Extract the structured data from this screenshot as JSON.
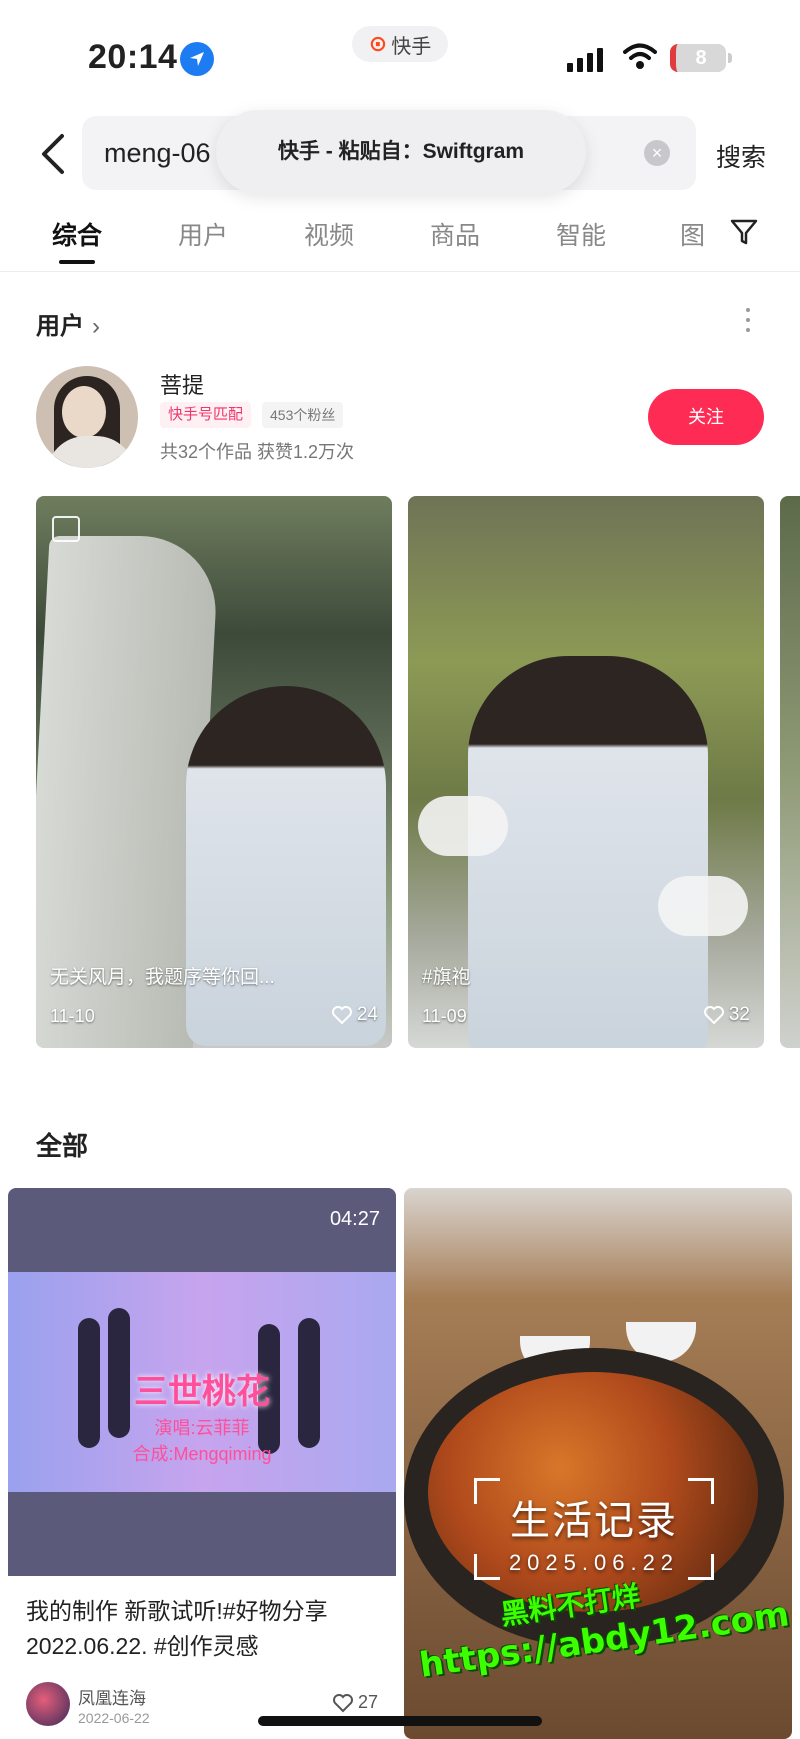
{
  "status_bar": {
    "time": "20:14",
    "island_label": "快手",
    "battery": "8"
  },
  "search": {
    "query": "meng-06",
    "submit_label": "搜索",
    "paste_toast": "快手 - 粘贴自：Swiftgram"
  },
  "tabs": [
    {
      "label": "综合",
      "active": true
    },
    {
      "label": "用户"
    },
    {
      "label": "视频"
    },
    {
      "label": "商品"
    },
    {
      "label": "智能"
    },
    {
      "label": "图"
    }
  ],
  "user_section": {
    "title": "用户",
    "user": {
      "name": "菩提",
      "match_badge": "快手号匹配",
      "fans": "453个粉丝",
      "stats": "共32个作品 获赞1.2万次",
      "follow_label": "关注"
    },
    "photos": [
      {
        "caption": "无关风月，我题序等你回...",
        "date": "11-10",
        "likes": "24"
      },
      {
        "caption": "#旗袍",
        "date": "11-09",
        "likes": "32"
      }
    ]
  },
  "all_section": {
    "title": "全部",
    "cards": [
      {
        "duration": "04:27",
        "song_title": "三世桃花",
        "singer": "演唱:云菲菲",
        "mixer": "合成:Mengqiming",
        "description": "我的制作 新歌试听!#好物分享 2022.06.22. #创作灵感",
        "author": "凤凰连海",
        "author_date": "2022-06-22",
        "likes": "27"
      },
      {
        "overlay_title": "生活记录",
        "overlay_date": "2025.06.22"
      }
    ]
  },
  "watermark": {
    "line1": "黑料不打烊",
    "line2": "https://abdy12.com"
  },
  "colors": {
    "follow": "#fe2c55",
    "match_badge": "#f0356e",
    "location": "#1e7cf2",
    "battery_low": "#e03c3c",
    "watermark": "#3cff00"
  },
  "icons": [
    "location-arrow-icon",
    "signal-icon",
    "wifi-icon",
    "battery-icon",
    "back-icon",
    "clear-icon",
    "filter-icon",
    "more-icon",
    "chevron-right-icon",
    "multi-image-icon",
    "heart-icon"
  ]
}
